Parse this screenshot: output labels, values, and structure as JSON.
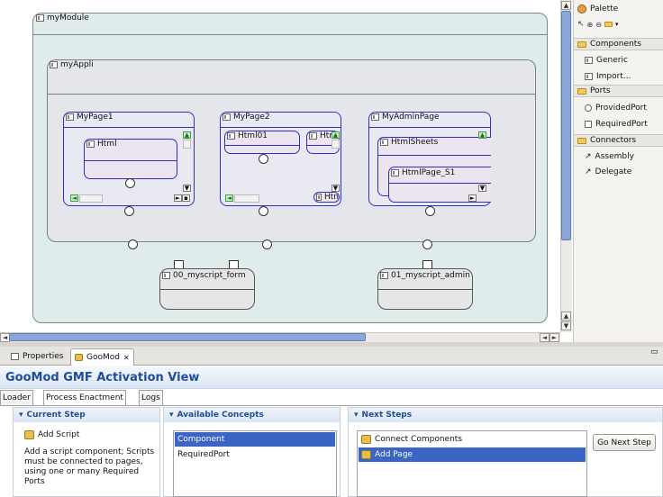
{
  "diagram": {
    "module": {
      "label": "myModule"
    },
    "appli": {
      "label": "myAppli"
    },
    "pages": [
      {
        "label": "MyPage1",
        "inner": [
          "Html"
        ]
      },
      {
        "label": "MyPage2",
        "inner": [
          "Html01",
          "Htm",
          "Htn"
        ]
      },
      {
        "label": "MyAdminPage",
        "inner": [
          "HtmlSheets",
          "HtmlPage_S1"
        ]
      }
    ],
    "scripts": [
      {
        "label": "00_myscript_form"
      },
      {
        "label": "01_myscript_admin"
      }
    ]
  },
  "palette": {
    "title": "Palette",
    "drawers": [
      {
        "label": "Components",
        "items": [
          "Generic",
          "Import..."
        ]
      },
      {
        "label": "Ports",
        "items": [
          "ProvidedPort",
          "RequiredPort"
        ]
      },
      {
        "label": "Connectors",
        "items": [
          "Assembly",
          "Delegate"
        ]
      }
    ]
  },
  "views": {
    "tabs": [
      {
        "label": "Properties"
      },
      {
        "label": "GooMod"
      }
    ]
  },
  "goomod": {
    "title": "GooMod GMF Activation View",
    "subtabs": [
      "Loader",
      "Process Enactment",
      "Logs"
    ],
    "current_step": {
      "header": "Current Step",
      "step": "Add Script",
      "description": "Add a script component; Scripts must be connected to pages, using one or many Required Ports"
    },
    "available_concepts": {
      "header": "Available Concepts",
      "items": [
        "Component",
        "RequiredPort"
      ]
    },
    "next_steps": {
      "header": "Next Steps",
      "items": [
        "Connect Components",
        "Add Page"
      ]
    },
    "go_button": "Go Next Step"
  },
  "colors": {
    "accent": "#3a65c4",
    "title": "#1f4d9a",
    "page_border": "#3030c8"
  }
}
